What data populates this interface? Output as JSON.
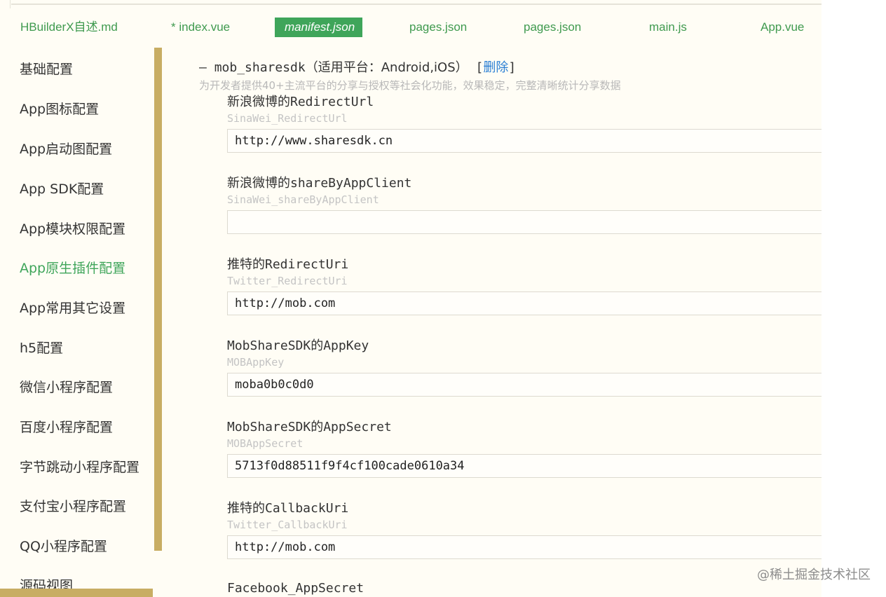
{
  "tabs": [
    {
      "label": "HBuilderX自述.md"
    },
    {
      "label": "* index.vue"
    },
    {
      "label": "manifest.json"
    },
    {
      "label": "pages.json"
    },
    {
      "label": "pages.json"
    },
    {
      "label": "main.js"
    },
    {
      "label": "App.vue"
    }
  ],
  "sidebar": {
    "items": [
      {
        "label": "基础配置"
      },
      {
        "label": "App图标配置"
      },
      {
        "label": "App启动图配置"
      },
      {
        "label": "App SDK配置"
      },
      {
        "label": "App模块权限配置"
      },
      {
        "label": "App原生插件配置"
      },
      {
        "label": "App常用其它设置"
      },
      {
        "label": "h5配置"
      },
      {
        "label": "微信小程序配置"
      },
      {
        "label": "百度小程序配置"
      },
      {
        "label": "字节跳动小程序配置"
      },
      {
        "label": "支付宝小程序配置"
      },
      {
        "label": "QQ小程序配置"
      },
      {
        "label": "源码视图"
      }
    ]
  },
  "plugin": {
    "dash": "–",
    "name": "mob_sharesdk",
    "platforms": "（适用平台：Android,iOS）",
    "delete_open": "[",
    "delete_label": "删除",
    "delete_close": "]",
    "description": "为开发者提供40+主流平台的分享与授权等社会化功能，效果稳定，完整清晰统计分享数据"
  },
  "fields": [
    {
      "label": "新浪微博的RedirectUrl",
      "key": "SinaWei_RedirectUrl",
      "value": "http://www.sharesdk.cn"
    },
    {
      "label": "新浪微博的shareByAppClient",
      "key": "SinaWei_shareByAppClient",
      "value": ""
    },
    {
      "label": "推特的RedirectUri",
      "key": "Twitter_RedirectUri",
      "value": "http://mob.com"
    },
    {
      "label": "MobShareSDK的AppKey",
      "key": "MOBAppKey",
      "value": "moba0b0c0d0"
    },
    {
      "label": "MobShareSDK的AppSecret",
      "key": "MOBAppSecret",
      "value": "5713f0d88511f9f4cf100cade0610a34"
    },
    {
      "label": "推特的CallbackUri",
      "key": "Twitter_CallbackUri",
      "value": "http://mob.com"
    },
    {
      "label": "Facebook_AppSecret",
      "key": "",
      "value": ""
    }
  ],
  "watermark": "@稀土掘金技术社区",
  "colors": {
    "accent_green": "#3fa55a",
    "tab_text_green": "#3f9a4f",
    "scrollbar_gold": "#c8ad63",
    "link_blue": "#2a7fd4",
    "background": "#fffdf5"
  }
}
